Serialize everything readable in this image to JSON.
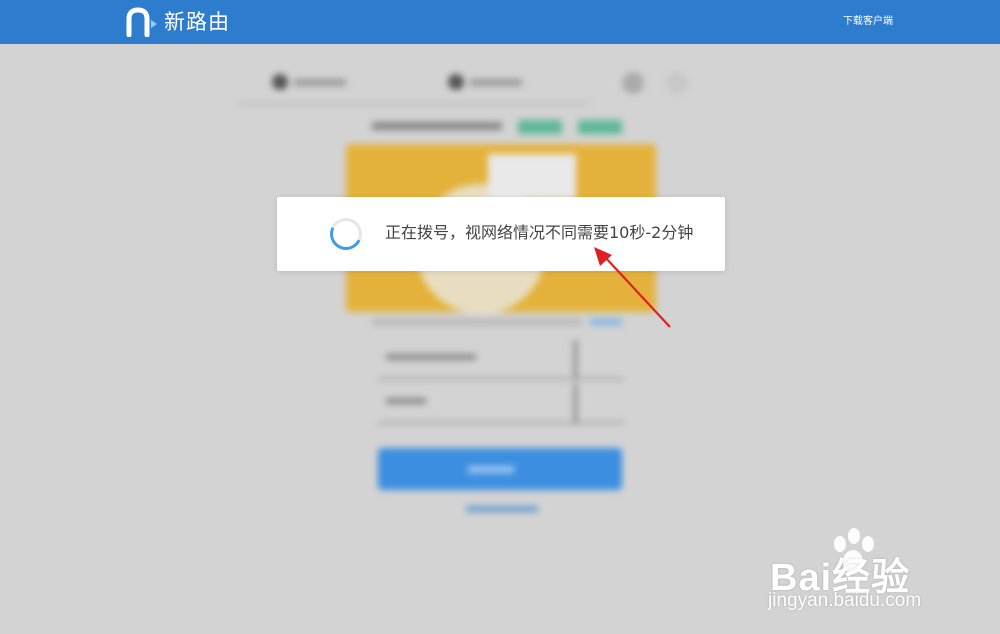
{
  "header": {
    "brand": "新路由",
    "download_link": "下载客户端",
    "logo_icon": "router-logo-icon",
    "bg_color": "#2d7ccd"
  },
  "modal": {
    "message": "正在拨号，视网络情况不同需要10秒-2分钟",
    "spinner_icon": "loading-spinner-icon",
    "spinner_color": "#3e9be6"
  },
  "annotation": {
    "arrow_icon": "red-arrow-icon",
    "color": "#e02020"
  },
  "watermark": {
    "text": "Bai经验",
    "sub": "jingyan.baidu.com",
    "paw_icon": "baidu-paw-icon"
  }
}
